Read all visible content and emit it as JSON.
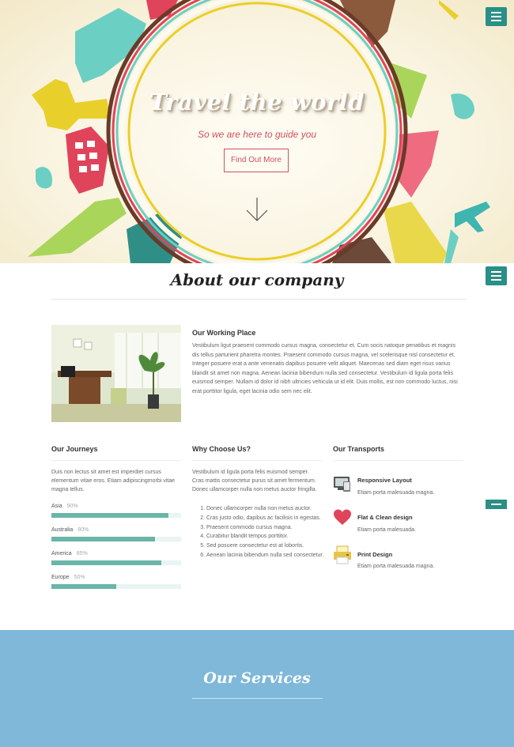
{
  "hero": {
    "title": "Travel the world",
    "subtitle": "So we are here to guide you",
    "button": "Find Out More"
  },
  "about": {
    "title": "About our company",
    "working_title": "Our Working Place",
    "working_text": "Vestibulum ligut praesent commodo cursus magna, consectetur et. Cum socis natoque penatibus et magnis dis tellus parturient pharetra montes. Praesent commodo cursus magna, vel scelerisque nisl consectetur et. Integer posuere erat a ante venenatis dapibus posuere velit aliquet. Maecenas sed diam eget risus varius blandit sit amet non magna. Aenean lacinia bibendum nulla sed consectetur. Vestibulum id ligula porta felis euismod semper. Nullam id dolor id nibh ultricies vehicula ut id elit. Duis mollis, est non commodo luctus, nisi erat porttitor ligula, eget lacinia odio sem nec elit."
  },
  "journeys": {
    "title": "Our Journeys",
    "text": "Duis non lectus sit amet est imperdiet cursus elementum vitae eros. Etiam adipiscingmorbi vitae magna tellus.",
    "skills": [
      {
        "label": "Asia",
        "pct": "90%",
        "value": 0.9
      },
      {
        "label": "Australia",
        "pct": "80%",
        "value": 0.8
      },
      {
        "label": "America",
        "pct": "85%",
        "value": 0.85
      },
      {
        "label": "Europe",
        "pct": "50%",
        "value": 0.5
      }
    ]
  },
  "why": {
    "title": "Why Choose Us?",
    "text": "Vestibulum id ligula porta felis euismod semper. Cras mattis consectetur purus sit amet fermentum. Donec ullamcorper nulla non metus auctor fringilla.",
    "items": [
      "Donec ullamcorper nulla non metus auctor.",
      "Cras justo odio, dapibus ac facilisis in egestas.",
      "Praesent commodo cursus magna.",
      "Curabitur blandit tempus porttitor.",
      "Sed posuere consectetur est at lobortis.",
      "Aenean lacinia bibendum nulla sed consectetur."
    ]
  },
  "transports": {
    "title": "Our Transports",
    "items": [
      {
        "title": "Responsive Layout",
        "text": "Etiam porta malesuada magna.",
        "icon": "devices-icon"
      },
      {
        "title": "Flat & Clean design",
        "text": "Etiam porta malesuada.",
        "icon": "heart-icon"
      },
      {
        "title": "Print Design",
        "text": "Etiam porta malesuada magna.",
        "icon": "printer-icon"
      }
    ]
  },
  "services": {
    "title": "Our Services"
  },
  "colors": {
    "accent": "#2a8f86",
    "skill_bar": "#6ab5a7",
    "hero_red": "#d0505e",
    "services_bg": "#7fb8d9"
  }
}
